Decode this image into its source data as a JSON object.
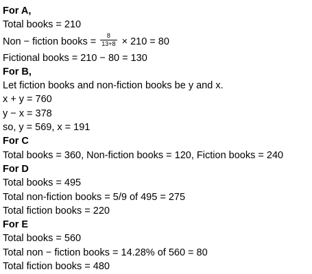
{
  "sections": {
    "a": {
      "heading": "For A,",
      "total": "Total books = 210",
      "nonfiction_prefix": "Non − fiction books =",
      "fraction_numerator": "8",
      "fraction_denominator": "13+8",
      "nonfiction_suffix": "× 210 = 80",
      "fictional": "Fictional books = 210 − 80 = 130"
    },
    "b": {
      "heading": "For B,",
      "intro": "Let fiction books and non-fiction books be y and x.",
      "eq1": "x + y = 760",
      "eq2": "y − x = 378",
      "result": "so, y = 569,  x = 191"
    },
    "c": {
      "heading": "For C",
      "summary": "Total books  = 360, Non-fiction books = 120, Fiction books = 240"
    },
    "d": {
      "heading": "For D",
      "total": "Total books = 495",
      "nonfiction": "Total non-fiction books = 5/9 of 495 = 275",
      "fiction": "Total fiction books = 220"
    },
    "e": {
      "heading": "For E",
      "total": "Total books = 560",
      "nonfiction": "Total non − fiction books = 14.28% of 560 = 80",
      "fiction": "Total fiction books = 480"
    }
  }
}
